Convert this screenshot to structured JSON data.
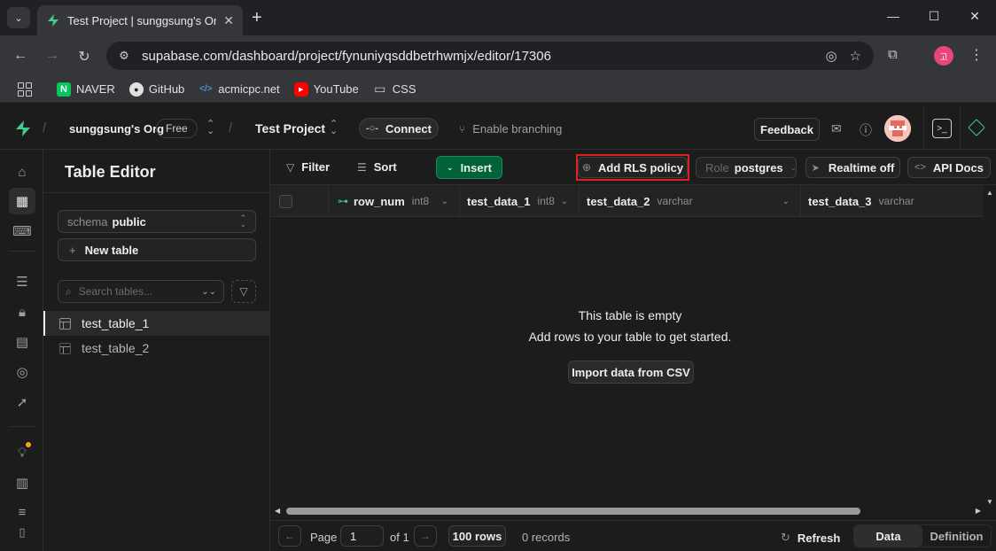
{
  "browser": {
    "tab_title": "Test Project | sunggsung's Org",
    "url": "supabase.com/dashboard/project/fynuniyqsddbetrhwmjx/editor/17306",
    "profile_initial": "고",
    "bookmarks": [
      {
        "label": "NAVER",
        "icon": "naver-icon"
      },
      {
        "label": "GitHub",
        "icon": "github-icon"
      },
      {
        "label": "acmicpc.net",
        "icon": "code-icon"
      },
      {
        "label": "YouTube",
        "icon": "youtube-icon"
      },
      {
        "label": "CSS",
        "icon": "folder-icon"
      }
    ]
  },
  "topbar": {
    "org_name": "sunggsung's Org",
    "plan_badge": "Free",
    "project_name": "Test Project",
    "connect_label": "Connect",
    "branching_label": "Enable branching",
    "feedback_label": "Feedback"
  },
  "sidebar": {
    "title": "Table Editor",
    "schema_label": "schema",
    "schema_value": "public",
    "new_table_label": "New table",
    "search_placeholder": "Search tables...",
    "tables": [
      {
        "name": "test_table_1",
        "active": true
      },
      {
        "name": "test_table_2",
        "active": false
      }
    ]
  },
  "toolbar": {
    "filter_label": "Filter",
    "sort_label": "Sort",
    "insert_label": "Insert",
    "rls_label": "Add RLS policy",
    "role_label": "Role",
    "role_value": "postgres",
    "realtime_label": "Realtime off",
    "api_docs_label": "API Docs"
  },
  "grid": {
    "columns": [
      {
        "name": "row_num",
        "type": "int8",
        "primary_key": true
      },
      {
        "name": "test_data_1",
        "type": "int8"
      },
      {
        "name": "test_data_2",
        "type": "varchar"
      },
      {
        "name": "test_data_3",
        "type": "varchar"
      }
    ],
    "empty_title": "This table is empty",
    "empty_subtitle": "Add rows to your table to get started.",
    "import_label": "Import data from CSV"
  },
  "footer": {
    "page_label": "Page",
    "page_value": "1",
    "of_label": "of 1",
    "rows_label": "100 rows",
    "records_label": "0 records",
    "refresh_label": "Refresh",
    "data_tab": "Data",
    "definition_tab": "Definition"
  },
  "colors": {
    "brand": "#3ecf8e",
    "insert_bg": "#006239",
    "highlight": "#e31e24"
  }
}
